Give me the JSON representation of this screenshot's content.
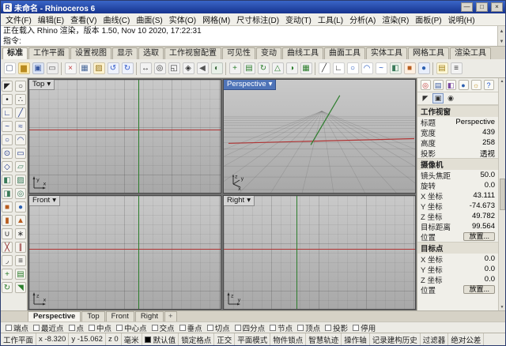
{
  "colors": {
    "titlebar": "#16338e",
    "active_viewport_title": "#4f74b8",
    "axis_x": "#b03434",
    "axis_y": "#2c7d2c",
    "layer_swatch": "#000000"
  },
  "titlebar": {
    "app_glyph": "R",
    "title": "未命名 - Rhinoceros 6",
    "minimize": "—",
    "maximize": "□",
    "close": "×"
  },
  "menubar": {
    "items": [
      "文件(F)",
      "编辑(E)",
      "查看(V)",
      "曲线(C)",
      "曲面(S)",
      "实体(O)",
      "网格(M)",
      "尺寸标注(D)",
      "变动(T)",
      "工具(L)",
      "分析(A)",
      "渲染(R)",
      "面板(P)",
      "说明(H)"
    ]
  },
  "command": {
    "history_line": "正在载入 Rhino 渲染，版本 1.50, Nov 10 2020, 17:22:31",
    "prompt": "指令:"
  },
  "scrollbar": {
    "up": "▲",
    "down": "▼"
  },
  "ribbon": {
    "overflow_glyph": "≡",
    "tabs": [
      {
        "label": "标准",
        "active": true
      },
      {
        "label": "工作平面"
      },
      {
        "label": "设置视图"
      },
      {
        "label": "显示"
      },
      {
        "label": "选取"
      },
      {
        "label": "工作视窗配置"
      },
      {
        "label": "可见性"
      },
      {
        "label": "变动"
      },
      {
        "label": "曲线工具"
      },
      {
        "label": "曲面工具"
      },
      {
        "label": "实体工具"
      },
      {
        "label": "网格工具"
      },
      {
        "label": "渲染工具"
      }
    ]
  },
  "toolbar": {
    "icons": [
      {
        "name": "new-file-icon",
        "glyph": "▢",
        "bg": "#ffffff",
        "fg": "#55627f"
      },
      {
        "name": "open-file-icon",
        "glyph": "▆",
        "bg": "#ffe9a8",
        "fg": "#b98a1e"
      },
      {
        "name": "save-icon",
        "glyph": "▣",
        "bg": "#dde6f7",
        "fg": "#3b5aa0"
      },
      {
        "name": "print-icon",
        "glyph": "▭",
        "bg": "#ededed",
        "fg": "#555555"
      },
      {
        "cls": "sep"
      },
      {
        "name": "cut-icon",
        "glyph": "×",
        "bg": "#f6f6f6",
        "fg": "#c04040"
      },
      {
        "name": "copy-icon",
        "glyph": "▦",
        "bg": "#f6f6f6",
        "fg": "#4a6a9a"
      },
      {
        "name": "paste-icon",
        "glyph": "▨",
        "bg": "#fff3cf",
        "fg": "#927018"
      },
      {
        "name": "undo-icon",
        "glyph": "↺",
        "bg": "#eef2fc",
        "fg": "#2f58c8"
      },
      {
        "name": "redo-icon",
        "glyph": "↻",
        "bg": "#eef2fc",
        "fg": "#2f58c8"
      },
      {
        "cls": "sep"
      },
      {
        "name": "pan-icon",
        "glyph": "↔",
        "bg": "#f2f2f2",
        "fg": "#333333"
      },
      {
        "name": "zoom-dynamic-icon",
        "glyph": "◎",
        "bg": "#f2f2f2",
        "fg": "#333333"
      },
      {
        "name": "zoom-window-icon",
        "glyph": "◱",
        "bg": "#f2f2f2",
        "fg": "#333333"
      },
      {
        "name": "zoom-extents-icon",
        "glyph": "◈",
        "bg": "#f2f2f2",
        "fg": "#333333"
      },
      {
        "name": "undo-view-icon",
        "glyph": "◀",
        "bg": "#f2f2f2",
        "fg": "#555555"
      },
      {
        "name": "shaded-view-icon",
        "glyph": "◐",
        "bg": "#e8f0e8",
        "fg": "#3a6a3a"
      },
      {
        "cls": "sep"
      },
      {
        "name": "move-icon",
        "glyph": "+",
        "bg": "#f2f2f2",
        "fg": "#2c7d2c"
      },
      {
        "name": "copy-object-icon",
        "glyph": "▤",
        "bg": "#f2f2f2",
        "fg": "#2c7d2c"
      },
      {
        "name": "rotate-icon",
        "glyph": "↻",
        "bg": "#f2f2f2",
        "fg": "#2c7d2c"
      },
      {
        "name": "scale-icon",
        "glyph": "△",
        "bg": "#f2f2f2",
        "fg": "#2c7d2c"
      },
      {
        "name": "mirror-icon",
        "glyph": "◑",
        "bg": "#f2f2f2",
        "fg": "#2c7d2c"
      },
      {
        "name": "array-icon",
        "glyph": "▦",
        "bg": "#f2f2f2",
        "fg": "#2c7d2c"
      },
      {
        "cls": "sep"
      },
      {
        "name": "line-icon",
        "glyph": "╱",
        "bg": "#ffffff",
        "fg": "#333333"
      },
      {
        "name": "polyline-icon",
        "glyph": "∟",
        "bg": "#ffffff",
        "fg": "#333333"
      },
      {
        "name": "circle-icon",
        "glyph": "○",
        "bg": "#ffffff",
        "fg": "#2255bb"
      },
      {
        "name": "arc-icon",
        "glyph": "◠",
        "bg": "#ffffff",
        "fg": "#2255bb"
      },
      {
        "name": "curve-icon",
        "glyph": "~",
        "bg": "#ffffff",
        "fg": "#2255bb"
      },
      {
        "name": "surface-icon",
        "glyph": "◧",
        "bg": "#eaf2ea",
        "fg": "#3a7a5a"
      },
      {
        "name": "box-icon",
        "glyph": "■",
        "bg": "#fdf0e2",
        "fg": "#b85c1e"
      },
      {
        "name": "sphere-icon",
        "glyph": "●",
        "bg": "#e8eefb",
        "fg": "#2b5fb0"
      },
      {
        "cls": "sep"
      },
      {
        "name": "layers-icon",
        "glyph": "▤",
        "bg": "#fff8d8",
        "fg": "#a08018"
      },
      {
        "name": "object-properties-icon",
        "glyph": "≡",
        "bg": "#f2f2f2",
        "fg": "#333333"
      }
    ]
  },
  "sidebar": {
    "icons": [
      {
        "name": "select-pointer-icon",
        "glyph": "◤",
        "fg": "#222222"
      },
      {
        "name": "lasso-select-icon",
        "glyph": "○",
        "fg": "#222222"
      },
      {
        "name": "point-icon",
        "glyph": "•",
        "fg": "#222222"
      },
      {
        "name": "points-icon",
        "glyph": "∴",
        "fg": "#222222"
      },
      {
        "name": "polyline-tool-icon",
        "glyph": "∟",
        "fg": "#223a8a"
      },
      {
        "name": "line-tool-icon",
        "glyph": "╱",
        "fg": "#223a8a"
      },
      {
        "name": "curve-tool-icon",
        "glyph": "~",
        "fg": "#223a8a"
      },
      {
        "name": "interpolate-curve-icon",
        "glyph": "≈",
        "fg": "#223a8a"
      },
      {
        "name": "circle-tool-icon",
        "glyph": "○",
        "fg": "#223a8a"
      },
      {
        "name": "arc-tool-icon",
        "glyph": "◠",
        "fg": "#223a8a"
      },
      {
        "name": "ellipse-tool-icon",
        "glyph": "⊙",
        "fg": "#223a8a"
      },
      {
        "name": "rectangle-tool-icon",
        "glyph": "▭",
        "fg": "#223a8a"
      },
      {
        "name": "polygon-tool-icon",
        "glyph": "◇",
        "fg": "#223a8a"
      },
      {
        "name": "plane-tool-icon",
        "glyph": "▱",
        "fg": "#3a7a5a"
      },
      {
        "name": "surface-tool-icon",
        "glyph": "◧",
        "fg": "#3a7a5a"
      },
      {
        "name": "loft-tool-icon",
        "glyph": "▨",
        "fg": "#3a7a5a"
      },
      {
        "name": "extrude-tool-icon",
        "glyph": "◨",
        "fg": "#3a7a5a"
      },
      {
        "name": "revolve-tool-icon",
        "glyph": "◎",
        "fg": "#3a7a5a"
      },
      {
        "name": "box-tool-icon",
        "glyph": "■",
        "fg": "#b85c1e"
      },
      {
        "name": "sphere-tool-icon",
        "glyph": "●",
        "fg": "#2b5fb0"
      },
      {
        "name": "cylinder-tool-icon",
        "glyph": "▮",
        "fg": "#b85c1e"
      },
      {
        "name": "cone-tool-icon",
        "glyph": "▲",
        "fg": "#b85c1e"
      },
      {
        "name": "join-icon",
        "glyph": "∪",
        "fg": "#333333"
      },
      {
        "name": "explode-icon",
        "glyph": "∗",
        "fg": "#333333"
      },
      {
        "name": "trim-icon",
        "glyph": "╳",
        "fg": "#8a2222"
      },
      {
        "name": "split-icon",
        "glyph": "∥",
        "fg": "#8a2222"
      },
      {
        "name": "fillet-icon",
        "glyph": "◞",
        "fg": "#333333"
      },
      {
        "name": "offset-icon",
        "glyph": "≡",
        "fg": "#333333"
      },
      {
        "name": "move-tool-icon",
        "glyph": "+",
        "fg": "#2c7d2c"
      },
      {
        "name": "copy-tool-icon",
        "glyph": "▤",
        "fg": "#2c7d2c"
      },
      {
        "name": "rotate-tool-icon",
        "glyph": "↻",
        "fg": "#2c7d2c"
      },
      {
        "name": "scale-tool-icon",
        "glyph": "◥",
        "fg": "#2c7d2c"
      }
    ]
  },
  "viewports": {
    "menu_arrow": "▾",
    "top": {
      "title": "Top",
      "ax": "x",
      "ay": "y"
    },
    "perspective": {
      "title": "Perspective",
      "ax": "x",
      "ay": "y",
      "az": "z"
    },
    "front": {
      "title": "Front",
      "ax": "x",
      "ay": "z"
    },
    "right": {
      "title": "Right",
      "ax": "y",
      "ay": "z"
    }
  },
  "viewport_tabs": {
    "items": [
      {
        "label": "Perspective",
        "active": true,
        "name": "viewport-tab-perspective"
      },
      {
        "label": "Top",
        "name": "viewport-tab-top"
      },
      {
        "label": "Front",
        "name": "viewport-tab-front"
      },
      {
        "label": "Right",
        "name": "viewport-tab-right"
      },
      {
        "label": "+",
        "name": "new-viewport-tab-button",
        "cls": "plus"
      }
    ]
  },
  "panel": {
    "tab_icons": [
      {
        "name": "properties-tab-icon",
        "glyph": "◎",
        "fg": "#c23a3a"
      },
      {
        "name": "layers-tab-icon",
        "glyph": "▤",
        "fg": "#3b5aa0"
      },
      {
        "name": "display-tab-icon",
        "glyph": "◧",
        "fg": "#7a4aa0"
      },
      {
        "name": "materials-tab-icon",
        "glyph": "●",
        "fg": "#2b5fb0"
      },
      {
        "name": "lights-tab-icon",
        "glyph": "☼",
        "fg": "#c09020"
      },
      {
        "name": "help-tab-icon",
        "glyph": "?",
        "fg": "#2255cc"
      }
    ],
    "page_icons": [
      {
        "name": "object-page-icon",
        "glyph": "◤",
        "fg": "#333333"
      },
      {
        "name": "viewport-page-icon",
        "glyph": "▣",
        "fg": "#333333",
        "active": true
      },
      {
        "name": "camera-page-icon",
        "glyph": "◉",
        "fg": "#333333"
      }
    ],
    "rows": [
      {
        "cls": "header",
        "label": "工作视窗"
      },
      {
        "label": "标题",
        "value": "Perspective"
      },
      {
        "label": "宽度",
        "value": "439"
      },
      {
        "label": "高度",
        "value": "258"
      },
      {
        "label": "投影",
        "value": "透视"
      },
      {
        "cls": "header",
        "label": "摄像机"
      },
      {
        "label": "镜头焦距",
        "value": "50.0"
      },
      {
        "label": "旋转",
        "value": "0.0"
      },
      {
        "label": "X 坐标",
        "value": "43.111"
      },
      {
        "label": "Y 坐标",
        "value": "-74.673"
      },
      {
        "label": "Z 坐标",
        "value": "49.782"
      },
      {
        "label": "目标距离",
        "value": "99.564"
      },
      {
        "cls": "btnrow",
        "label": "位置",
        "value": "放置..."
      },
      {
        "cls": "header",
        "label": "目标点"
      },
      {
        "label": "X 坐标",
        "value": "0.0"
      },
      {
        "label": "Y 坐标",
        "value": "0.0"
      },
      {
        "label": "Z 坐标",
        "value": "0.0"
      },
      {
        "cls": "btnrow",
        "label": "位置",
        "value": "放置..."
      }
    ]
  },
  "osnap": {
    "items": [
      "端点",
      "最近点",
      "点",
      "中点",
      "中心点",
      "交点",
      "垂点",
      "切点",
      "四分点",
      "节点",
      "顶点",
      "投影",
      "停用"
    ]
  },
  "statusbar": {
    "items": [
      {
        "label": "工作平面",
        "name": "cplane-button"
      },
      {
        "label": "x -8.320",
        "name": "x-coordinate"
      },
      {
        "label": "y -15.062",
        "name": "y-coordinate"
      },
      {
        "label": "z 0",
        "name": "z-coordinate"
      },
      {
        "label": "毫米",
        "name": "units-display"
      },
      {
        "label": "默认值",
        "name": "layer-indicator",
        "swatch": "#000000"
      },
      {
        "label": "锁定格点",
        "name": "grid-snap-toggle"
      },
      {
        "label": "正交",
        "name": "ortho-toggle"
      },
      {
        "label": "平面模式",
        "name": "planar-toggle"
      },
      {
        "label": "物件锁点",
        "name": "osnap-toggle"
      },
      {
        "label": "智慧轨迹",
        "name": "smarttrack-toggle"
      },
      {
        "label": "操作轴",
        "name": "gumball-toggle"
      },
      {
        "label": "记录建构历史",
        "name": "history-toggle"
      },
      {
        "label": "过滤器",
        "name": "filter-toggle"
      },
      {
        "label": "绝对公差",
        "name": "tolerance-display"
      }
    ]
  }
}
